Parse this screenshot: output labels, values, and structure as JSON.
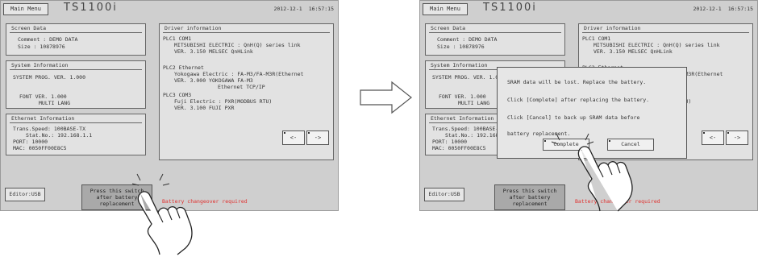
{
  "header": {
    "menu_label": "Main Menu",
    "model": "TS1100i",
    "date": "2012-12-1",
    "time": "16:57:15"
  },
  "screen_data": {
    "title": "Screen Data",
    "comment": "Comment : DEMO DATA",
    "size": "Size    : 10878976"
  },
  "system_info": {
    "title": "System Information",
    "prog": "SYSTEM PROG. VER. 1.000",
    "font": "FONT VER. 1.000",
    "lang": "MULTI LANG"
  },
  "ethernet_info": {
    "title": "Ethernet Information",
    "speed": "Trans.Speed: 100BASE-TX",
    "stat": "Stat.No.: 192.168.1.1",
    "port": "PORT: 10000",
    "mac": "MAC: 0050FF00E8C5"
  },
  "driver_info": {
    "title": "Driver information",
    "plc1_head": "PLC1 COM1",
    "plc1_l1": "MITSUBISHI ELECTRIC : QnH(Q) series link",
    "plc1_l2": "VER. 3.150 MELSEC QnHLink",
    "plc2_head": "PLC2 Ethernet",
    "plc2_l1": "Yokogawa Electric : FA-M3/FA-M3R(Ethernet",
    "plc2_l2": "VER. 3.000 YOKOGAWA FA-M3",
    "plc2_l3": "Ethernet TCP/IP",
    "plc3_head": "PLC3 COM3",
    "plc3_l1": "Fuji Electric : PXR(MODBUS RTU)",
    "plc3_l2": "VER. 3.100 FUJI PXR"
  },
  "nav": {
    "prev": "<-",
    "next": "->"
  },
  "footer": {
    "editor": "Editor:USB",
    "replace_l1": "Press this switch",
    "replace_l2": "after battery",
    "replace_l3": "replacement",
    "warning": "Battery changeover required"
  },
  "dialog": {
    "line1": "SRAM data will be lost. Replace the battery.",
    "line2": "Click [Complete] after replacing the battery.",
    "line3": "Click [Cancel] to back up SRAM data before",
    "line4": "battery replacement.",
    "complete": "Complete",
    "cancel": "Cancel"
  },
  "colors": {
    "screen_bg": "#cfcfcf",
    "panel_bg": "#e2e2e2",
    "warning": "#e0312f"
  }
}
